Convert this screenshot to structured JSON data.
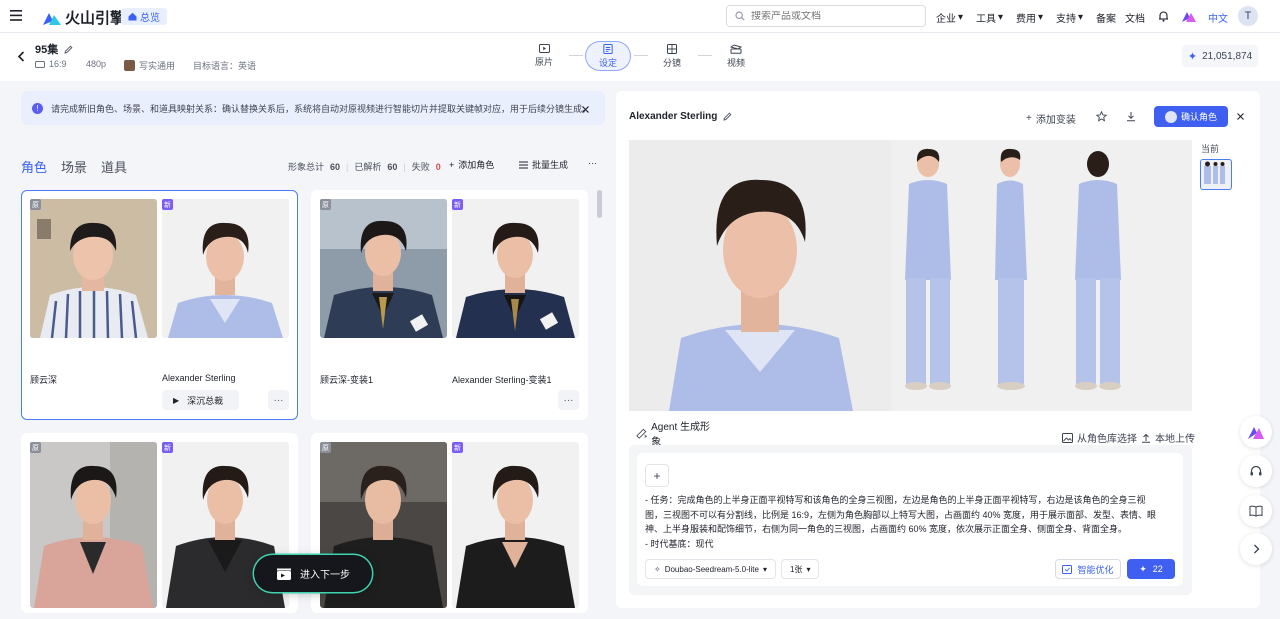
{
  "topbar": {
    "brand": "火山引擎",
    "home_badge": "总览",
    "search_placeholder": "搜索产品或文档",
    "nav": [
      "企业",
      "工具",
      "费用",
      "支持"
    ],
    "nav_plain": [
      "备案",
      "文档"
    ],
    "lang": "中文",
    "avatar_initial": "T"
  },
  "project": {
    "title": "95集",
    "ratio": "16:9",
    "resolution": "480p",
    "style": "写实通用",
    "target_lang": "目标语言：英语"
  },
  "steps": [
    {
      "label": "原片",
      "icon": "film-icon"
    },
    {
      "label": "设定",
      "icon": "document-icon"
    },
    {
      "label": "分镜",
      "icon": "storyboard-icon"
    },
    {
      "label": "视频",
      "icon": "video-icon"
    }
  ],
  "active_step": "设定",
  "points": "21,051,874",
  "notice": "请完成新旧角色、场景、和道具映射关系：确认替换关系后，系统将自动对原视频进行智能切片并提取关键帧对应，用于后续分镜生成。",
  "tabs": [
    "角色",
    "场景",
    "道具"
  ],
  "active_tab": "角色",
  "stats": {
    "total_label": "形象总计",
    "total": "60",
    "parsed_label": "已解析",
    "parsed": "60",
    "failed_label": "失败",
    "failed": "0"
  },
  "actions": {
    "add_role": "添加角色",
    "batch": "批量生成"
  },
  "cards": [
    {
      "orig_name": "顾云深",
      "new_name": "Alexander Sterling",
      "voice": "深沉总裁",
      "orig_tag": "原",
      "new_tag": "新"
    },
    {
      "orig_name": "顾云深-变装1",
      "new_name": "Alexander Sterling-变装1",
      "orig_tag": "原",
      "new_tag": "新"
    },
    {
      "orig_tag": "原",
      "new_tag": "新"
    },
    {
      "orig_tag": "原",
      "new_tag": "新"
    }
  ],
  "next_step": "进入下一步",
  "panel": {
    "title": "Alexander Sterling",
    "add_outfit": "添加变装",
    "confirm": "确认角色",
    "current": "当前",
    "agent_tab": "Agent 生成形象",
    "from_library": "从角色库选择",
    "local_upload": "本地上传",
    "prompt_lines": [
      "- 任务：完成角色的上半身正面平视特写和该角色的全身三视图，左边是角色的上半身正面平视特写，右边是该角色的全身三视",
      "图，三视图不可以有分割线，比例是 16:9，左侧为角色胸部以上特写大图，占画面约 40% 宽度，用于展示面部、发型、表情、眼",
      "神、上半身服装和配饰细节，右侧为同一角色的三视图，占画面约 60% 宽度，依次展示正面全身、侧面全身、背面全身。",
      "- 时代基底：现代"
    ],
    "model": "Doubao-Seedream-5.0-lite",
    "count": "1张",
    "optimize": "智能优化",
    "generate_cost": "22"
  },
  "colors": {
    "accent": "#3f5ff0",
    "tag_new": "#7b5cf5",
    "tag_orig": "#8a8f99",
    "pajama": "#aebde8"
  }
}
